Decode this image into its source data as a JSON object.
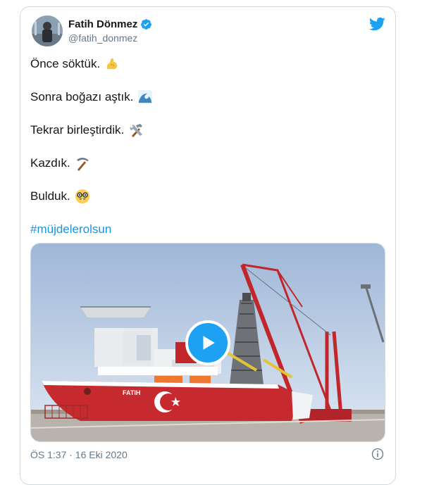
{
  "author": {
    "display_name": "Fatih Dönmez",
    "handle": "@fatih_donmez",
    "verified": true
  },
  "icons": {
    "verified": "verified-badge-icon",
    "brand": "twitter-bird-icon",
    "play": "play-icon",
    "info": "info-icon"
  },
  "colors": {
    "brand": "#1da1f2",
    "hashtag": "#1b95e0",
    "muted": "#657786",
    "text": "#14171a"
  },
  "tweet": {
    "lines": [
      {
        "text": "Önce söktük.",
        "emoji": "flexed-biceps-icon"
      },
      {
        "text": "Sonra boğazı aştık.",
        "emoji": "water-wave-icon"
      },
      {
        "text": "Tekrar birleştirdik.",
        "emoji": "hammer-and-wrench-icon"
      },
      {
        "text": "Kazdık.",
        "emoji": "pick-icon"
      },
      {
        "text": "Bulduk.",
        "emoji": "nerd-face-icon"
      }
    ],
    "hashtag": "#müjdelerolsun"
  },
  "media": {
    "type": "video",
    "ship_name": "FATIH"
  },
  "timestamp": "ÖS 1:37 · 16 Eki 2020"
}
